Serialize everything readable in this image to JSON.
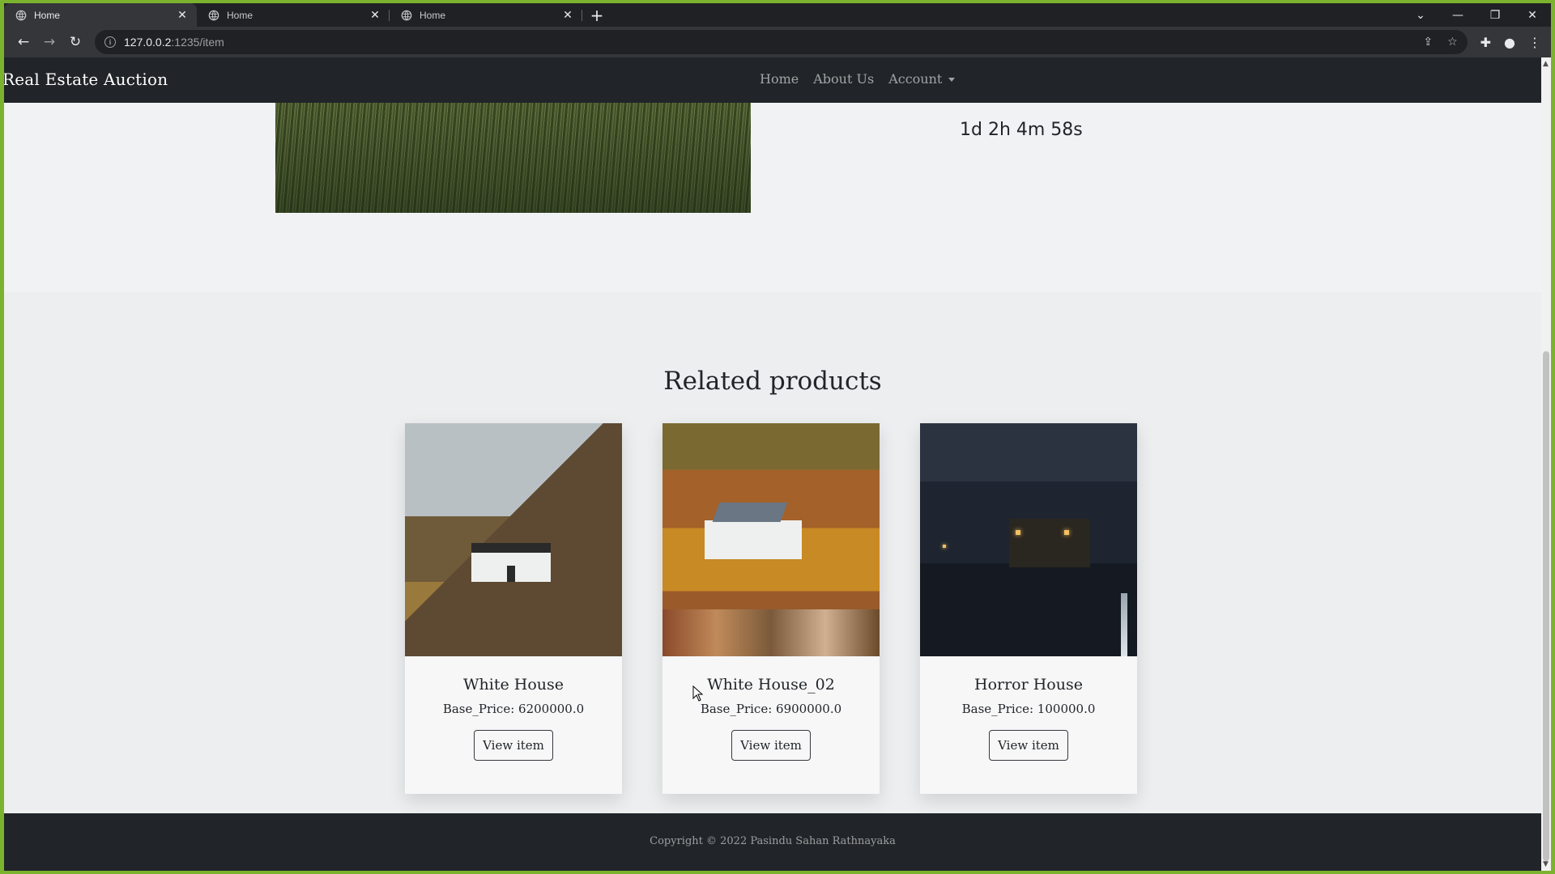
{
  "browser": {
    "tabs": [
      {
        "label": "Home",
        "active": true
      },
      {
        "label": "Home",
        "active": false
      },
      {
        "label": "Home",
        "active": false
      }
    ],
    "url_host": "127.0.0.2",
    "url_rest": ":1235/item"
  },
  "site": {
    "brand": "Real Estate Auction",
    "nav": {
      "home": "Home",
      "about": "About Us",
      "account": "Account"
    },
    "countdown": "1d 2h 4m 58s",
    "related_title": "Related products",
    "products": [
      {
        "title": "White House",
        "price": "Base_Price: 6200000.0",
        "button": "View item"
      },
      {
        "title": "White House_02",
        "price": "Base_Price: 6900000.0",
        "button": "View item"
      },
      {
        "title": "Horror House",
        "price": "Base_Price: 100000.0",
        "button": "View item"
      }
    ],
    "footer": "Copyright © 2022 Pasindu Sahan Rathnayaka"
  },
  "colors": {
    "navbar": "#212529",
    "page_bg": "#f1f2f3",
    "frame": "#7cb32e"
  }
}
